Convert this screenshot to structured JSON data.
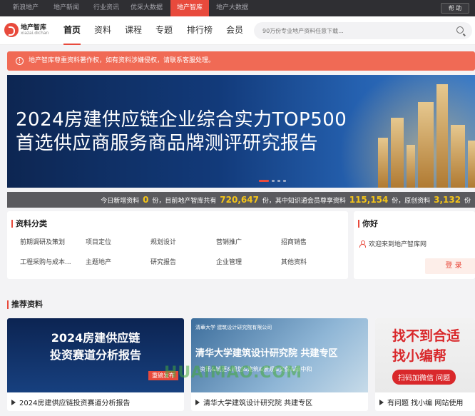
{
  "topbar": {
    "tabs": [
      "新浪地产",
      "地产新闻",
      "行业资讯",
      "优采大数据",
      "地产智库",
      "地产大数据"
    ],
    "active_tab": "地产智库",
    "help": "帮 助"
  },
  "header": {
    "logo_cn": "地产智库",
    "logo_en": "xiazai.dichan",
    "nav": [
      "首页",
      "资料",
      "课程",
      "专题",
      "排行榜",
      "会员"
    ],
    "active_nav": "首页",
    "search_placeholder": "90万份专业地产资料任意下载..."
  },
  "notice": {
    "text": "地产智库尊重资料著作权，如有资料涉嫌侵权，请联系客服处理。"
  },
  "banner": {
    "line1": "2024房建供应链企业综合实力TOP500",
    "line2": "首选供应商服务商品牌测评研究报告",
    "slides": 4,
    "active_slide": 0
  },
  "stats": {
    "prefix": "今日新增资料",
    "today": "0",
    "mid1": "份，目前地产智库共有",
    "total": "720,647",
    "mid2": "份，其中知识通会员尊享资料",
    "member": "115,154",
    "mid3": "份，原创资料",
    "original": "3,132",
    "suffix": "份"
  },
  "categories": {
    "title": "资料分类",
    "items": [
      "前期调研及策划",
      "项目定位",
      "规划设计",
      "营销推广",
      "招商销售",
      "工程采购与成本...",
      "主题地产",
      "研究报告",
      "企业管理",
      "其他资料"
    ]
  },
  "user_panel": {
    "title": "你好",
    "welcome": "欢迎来到地产智库网",
    "login": "登 录"
  },
  "recommend": {
    "title": "推荐资料",
    "items": [
      {
        "caption": "2024房建供应链投资赛道分析报告",
        "img_line1": "2024房建供应链",
        "img_line2": "投资赛道分析报告",
        "tag": "重磅发布"
      },
      {
        "caption": "清华大学建筑设计研究院 共建专区",
        "img_top": "清華大学 建筑设计研究院有限公司",
        "img_main": "清华大学建筑设计研究院 共建专区",
        "img_sub": "资讯&城更&规划&建筑&景观&文保&碳中和"
      },
      {
        "caption": "有问题 找小编 网站使用",
        "img_line1": "找不到合适",
        "img_line2": "找小编帮",
        "img_btn": "扫码加微信 问题"
      }
    ]
  },
  "watermark": "HUAIMAO.COM"
}
